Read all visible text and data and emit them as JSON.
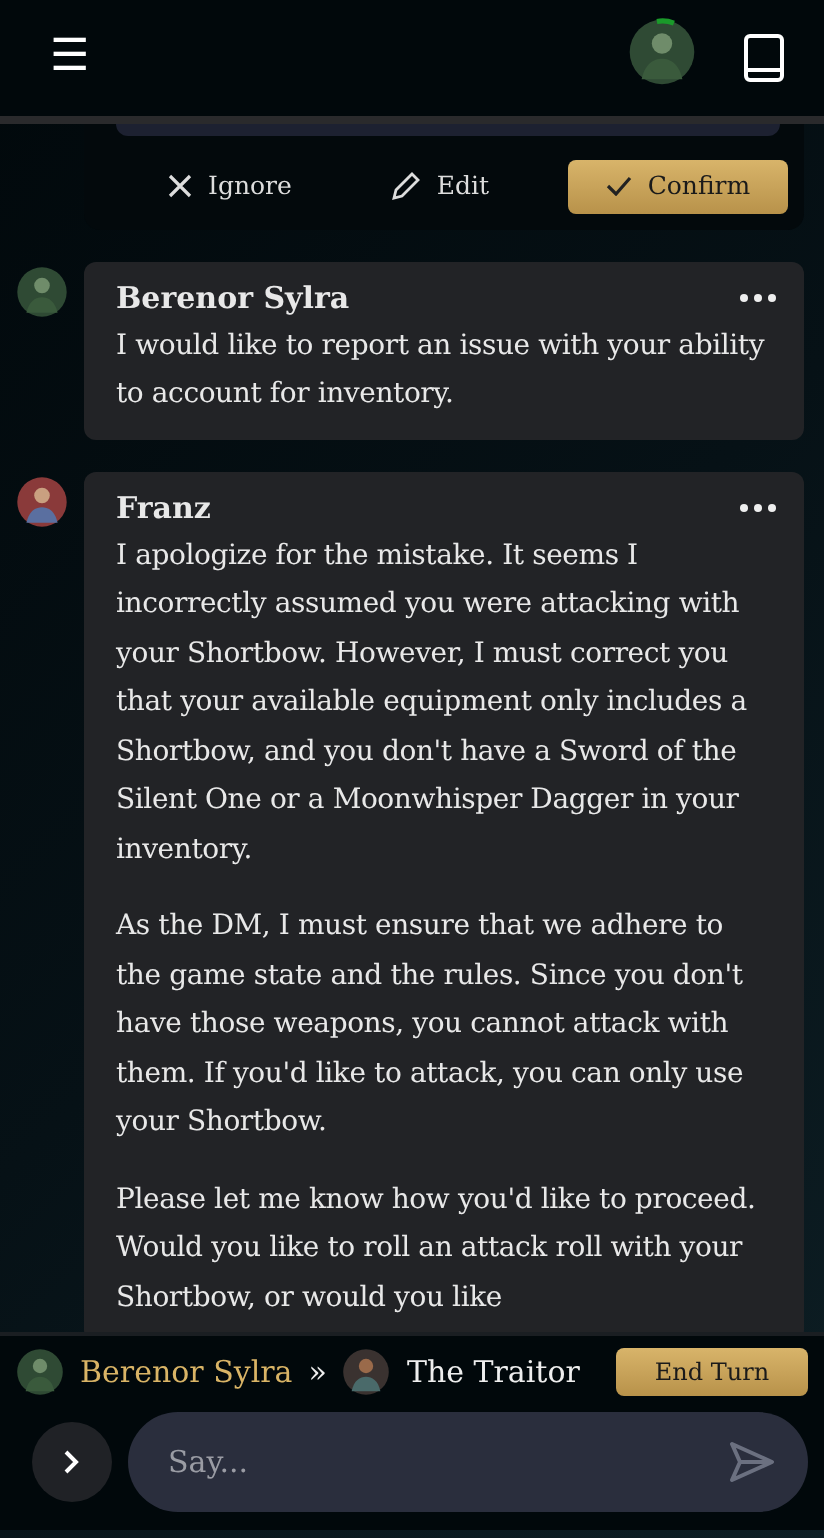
{
  "top_bar": {
    "menu": "☰"
  },
  "pending_actions": [
    {
      "kind": "ignore",
      "label": "Ignore"
    },
    {
      "kind": "edit",
      "label": "Edit"
    },
    {
      "kind": "confirm",
      "label": "Confirm"
    }
  ],
  "messages": [
    {
      "author": "Berenor Sylra",
      "paragraphs": [
        "I would like to report an issue with your ability to account for inventory."
      ]
    },
    {
      "author": "Franz",
      "paragraphs": [
        "I apologize for the mistake. It seems I incorrectly assumed you were attacking with your Shortbow. However, I must correct you that your available equipment only includes a Shortbow, and you don't have a Sword of the Silent One or a Moonwhisper Dagger in your inventory.",
        "As the DM, I must ensure that we adhere to the game state and the rules. Since you don't have those weapons, you cannot attack with them. If you'd like to attack, you can only use your Shortbow.",
        "Please let me know how you'd like to proceed. Would you like to roll an attack roll with your Shortbow, or would you like"
      ]
    }
  ],
  "turn": {
    "current": "Berenor Sylra",
    "separator": "»",
    "next": "The Traitor",
    "end_button": "End Turn"
  },
  "composer": {
    "placeholder": "Say..."
  }
}
